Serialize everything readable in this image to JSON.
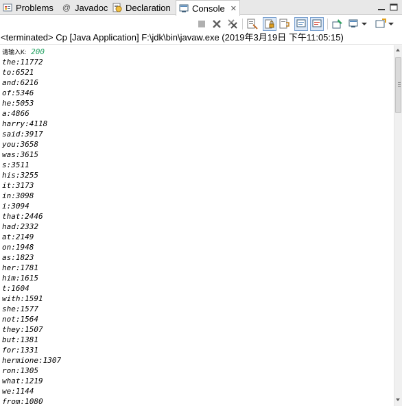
{
  "tabs": [
    {
      "label": "Problems",
      "icon": "problems-icon"
    },
    {
      "label": "Javadoc",
      "icon": "at-sign-icon",
      "glyph": "@"
    },
    {
      "label": "Declaration",
      "icon": "declaration-icon"
    },
    {
      "label": "Console",
      "icon": "console-icon",
      "active": true,
      "close": "✕"
    }
  ],
  "status": "<terminated> Cp [Java Application] F:\\jdk\\bin\\javaw.exe (2019年3月19日 下午11:05:15)",
  "prompt": {
    "label": "请输入K:",
    "value": "200"
  },
  "lines": [
    "the:11772",
    "to:6521",
    "and:6216",
    "of:5346",
    "he:5053",
    "a:4866",
    "harry:4118",
    "said:3917",
    "you:3658",
    "was:3615",
    "s:3511",
    "his:3255",
    "it:3173",
    "in:3098",
    "i:3094",
    "that:2446",
    "had:2332",
    "at:2149",
    "on:1948",
    "as:1823",
    "her:1781",
    "him:1615",
    "t:1604",
    "with:1591",
    "she:1577",
    "not:1564",
    "they:1507",
    "but:1381",
    "for:1331",
    "hermione:1307",
    "ron:1305",
    "what:1219",
    "we:1144",
    "from:1080"
  ],
  "toolbar": {
    "icons": [
      "terminate-icon",
      "remove-launch-icon",
      "remove-all-terminated-icon",
      "clear-console-icon",
      "scroll-lock-icon",
      "word-wrap-icon",
      "show-on-stdout-icon",
      "show-on-stderr-icon",
      "pin-console-icon",
      "display-console-icon",
      "open-console-icon"
    ]
  },
  "colors": {
    "input": "#20a060",
    "pressed": "#dbe8f7",
    "tabbar": "#e8e8e8"
  }
}
